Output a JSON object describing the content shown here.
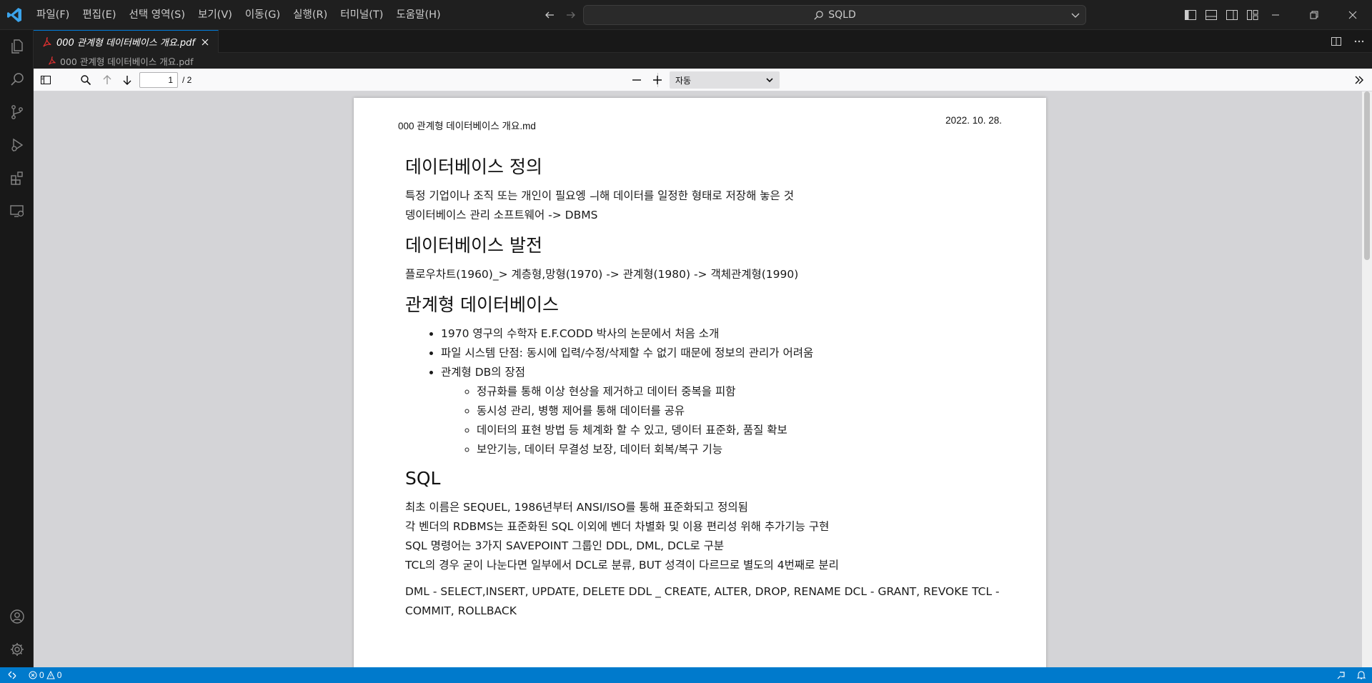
{
  "menubar": {
    "items": [
      "파일(F)",
      "편집(E)",
      "선택 영역(S)",
      "보기(V)",
      "이동(G)",
      "실행(R)",
      "터미널(T)",
      "도움말(H)"
    ]
  },
  "command_center": {
    "text": "SQLD"
  },
  "editor": {
    "active_tab": {
      "label": "000 관계형 데이터베이스 개요.pdf",
      "icon": "pdf-file-icon"
    },
    "breadcrumb": {
      "file": "000 관계형 데이터베이스 개요.pdf"
    }
  },
  "pdf_toolbar": {
    "current_page": "1",
    "total_pages": "/ 2",
    "zoom": "자동"
  },
  "document": {
    "header_left": "000 관계형 데이터베이스 개요.md",
    "header_right": "2022. 10. 28.",
    "sections": [
      {
        "heading": "데이터베이스 정의",
        "paragraphs": [
          "특정 기업이나 조직 또는 개인이 필요엥 ㅢ해 데이터를 일정한 형태로 저장해 놓은 것",
          "뎅이터베이스 관리 소프트웨어 -> DBMS"
        ]
      },
      {
        "heading": "데이터베이스 발전",
        "paragraphs": [
          "플로우차트(1960)_> 계층형,망형(1970) -> 관계형(1980) -> 객체관계형(1990)"
        ]
      },
      {
        "heading": "관계형 데이터베이스",
        "bullets": [
          "1970 영구의 수학자 E.F.CODD 박사의 논문에서 처음 소개",
          "파일 시스템 단점: 동시에 입력/수정/삭제할 수 없기 때문에 정보의 관리가 어려움",
          "관계형 DB의 장점"
        ],
        "sub_bullets": [
          "정규화를 통해 이상 현상을 제거하고 데이터 중복을 피함",
          "동시성 관리, 병행 제어를 통해 데이터를 공유",
          "데이터의 표현 방법 등 체계화 할 수 있고, 뎅이터 표준화, 품질 확보",
          "보안기능, 데이터 무결성 보장, 데이터 회복/복구 기능"
        ]
      },
      {
        "heading": "SQL",
        "paragraphs": [
          "최초 이름은 SEQUEL, 1986년부터 ANSI/ISO를 통해 표준화되고 정의됨",
          "각 벤더의 RDBMS는 표준화된 SQL 이외에 벤더 차별화 및 이용 편리성 위해 추가기능 구현",
          "SQL 명령어는 3가지 SAVEPOINT 그룹인 DDL, DML, DCL로 구분",
          "TCL의 경우 굳이 나눈다면 일부에서 DCL로 분류, BUT 성격이 다르므로 별도의 4번째로 분리"
        ],
        "paragraph_after": "DML - SELECT,INSERT, UPDATE, DELETE DDL _ CREATE, ALTER, DROP, RENAME DCL - GRANT, REVOKE TCL - COMMIT, ROLLBACK"
      }
    ]
  },
  "statusbar": {
    "errors": "0",
    "warnings": "0"
  },
  "colors": {
    "accent": "#007acc",
    "tab_active_border": "#0078d4",
    "pdf_icon": "#e03131"
  }
}
